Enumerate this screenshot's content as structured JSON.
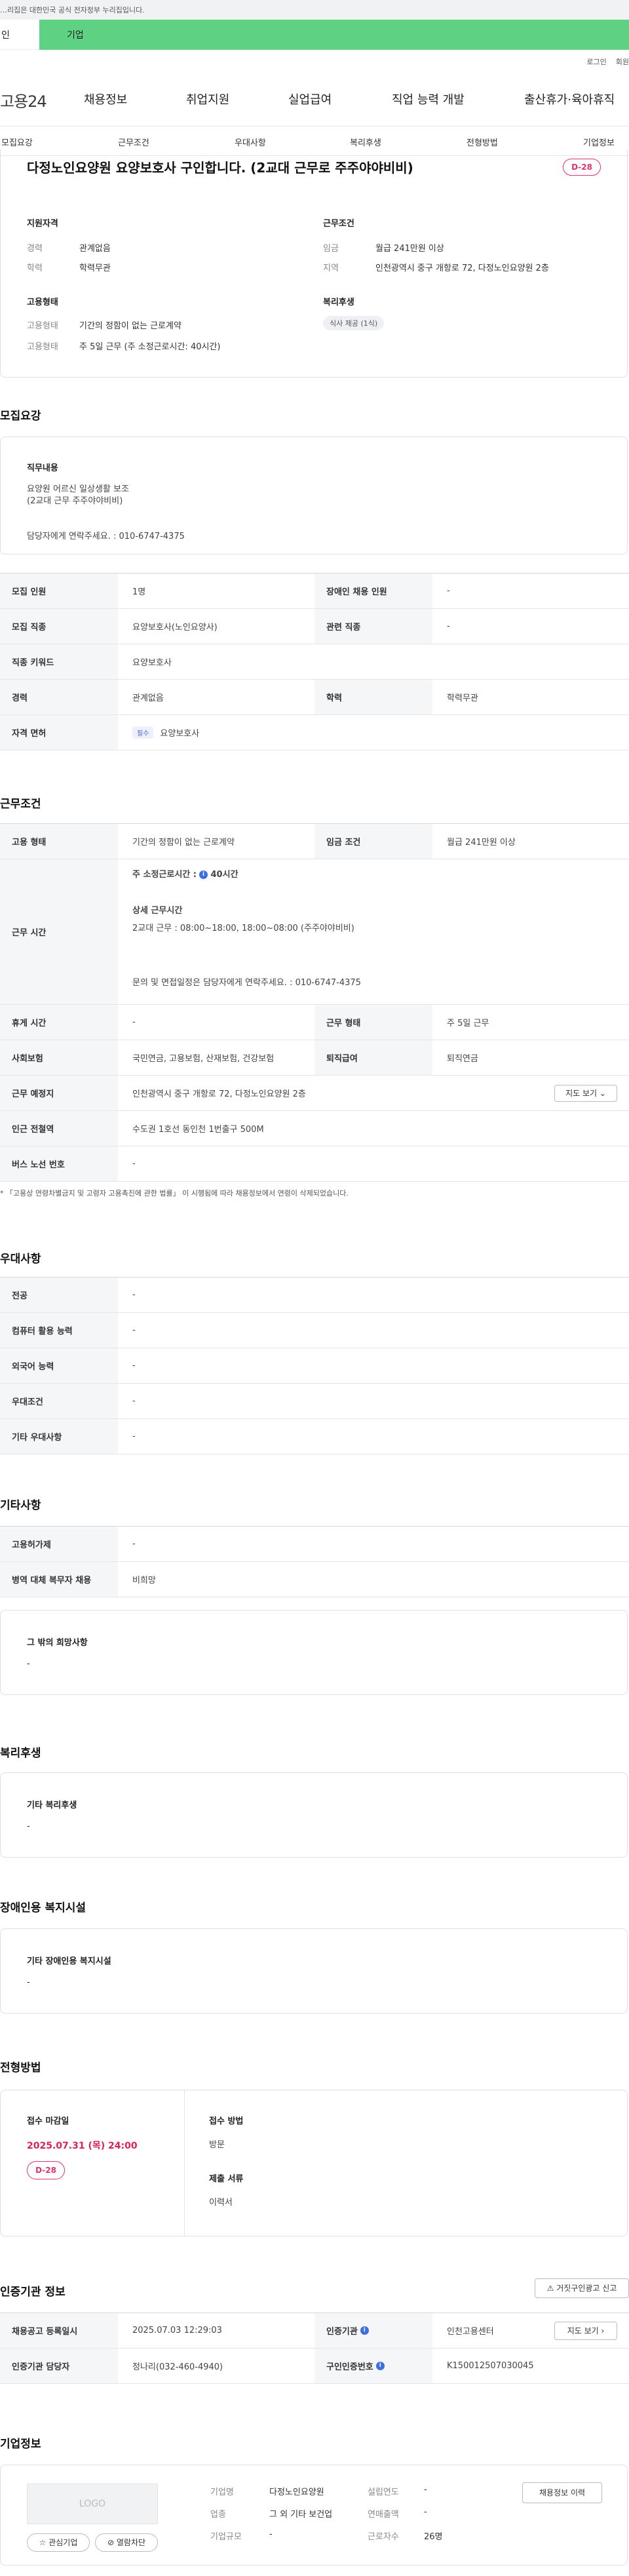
{
  "gov_banner": "…리집은 대한민국 공식 전자정부 누리집입니다.",
  "user_tabs": {
    "individual": "인",
    "business": "기업"
  },
  "util": {
    "login": "로그인",
    "signup": "회원"
  },
  "logo": "고용24",
  "gnb": [
    "채용정보",
    "취업지원",
    "실업급여",
    "직업 능력 개발",
    "출산휴가·육아휴직"
  ],
  "subnav": [
    "모집요강",
    "근무조건",
    "우대사항",
    "복리후생",
    "전형방법",
    "기업정보"
  ],
  "summary": {
    "title": "다정노인요양원 요양보호사 구인합니다. (2교대 근무로 주주야야비비)",
    "dday": "D-28",
    "qual_h": "지원자격",
    "career_k": "경력",
    "career_v": "관계없음",
    "edu_k": "학력",
    "edu_v": "학력무관",
    "emp_h": "고용형태",
    "emp_k1": "고용형태",
    "emp_v1": "기간의 정함이 없는 근로계약",
    "emp_k2": "고용형태",
    "emp_v2": "주 5일 근무 (주 소정근로시간: 40시간)",
    "cond_h": "근무조건",
    "wage_k": "임금",
    "wage_v": "월급 241만원 이상",
    "region_k": "지역",
    "region_v": "인천광역시 중구 개항로 72, 다정노인요양원 2층",
    "welfare_h": "복리후생",
    "welfare_chip": "식사 제공 (1식)"
  },
  "recruit": {
    "title": "모집요강",
    "job_h": "직무내용",
    "job_l1": "요양원 어르신 일상생활 보조",
    "job_l2": "(2교대 근무 주주야야비비)",
    "job_l3": "담당자에게 연락주세요. : 010-6747-4375",
    "rows": [
      [
        "모집 인원",
        "1명",
        "장애인 채용 인원",
        "-"
      ],
      [
        "모집 직종",
        "요양보호사(노인요양사)",
        "관련 직종",
        "-"
      ],
      [
        "직종 키워드",
        "요양보호사"
      ],
      [
        "경력",
        "관계없음",
        "학력",
        "학력무관"
      ]
    ],
    "license_k": "자격 면허",
    "license_tag": "필수",
    "license_v": "요양보호사"
  },
  "work": {
    "title": "근무조건",
    "emp_k": "고용 형태",
    "emp_v": "기간의 정함이 없는 근로계약",
    "wage_k": "임금 조건",
    "wage_v": "월급 241만원 이상",
    "time_k": "근무 시간",
    "time_l1": "주 소정근로시간 :",
    "time_hours": "40시간",
    "time_l2": "상세 근무시간",
    "time_l3": "2교대 근무 : 08:00~18:00, 18:00~08:00  (주주야야비비)",
    "time_l4": "문의 및 면접일정은 담당자에게 연락주세요. : 010-6747-4375",
    "rest_k": "휴게 시간",
    "rest_v": "-",
    "form_k": "근무 형태",
    "form_v": "주 5일 근무",
    "ins_k": "사회보험",
    "ins_v": "국민연금, 고용보험, 산재보험, 건강보험",
    "ret_k": "퇴직급여",
    "ret_v": "퇴직연금",
    "place_k": "근무 예정지",
    "place_v": "인천광역시 중구 개항로 72, 다정노인요양원 2층",
    "map_btn": "지도 보기",
    "sub_k": "인근 전철역",
    "sub_v": "수도권 1호선 동인천 1번출구 500M",
    "bus_k": "버스 노선 번호",
    "bus_v": "-",
    "note": "* 「고용상 연령차별금지 및 고령자 고용촉진에 관한 법률」 이 시행됨에 따라 채용정보에서 연령이 삭제되었습니다."
  },
  "pref": {
    "title": "우대사항",
    "rows": [
      [
        "전공",
        "-"
      ],
      [
        "컴퓨터 활용 능력",
        "-"
      ],
      [
        "외국어 능력",
        "-"
      ],
      [
        "우대조건",
        "-"
      ],
      [
        "기타 우대사항",
        "-"
      ]
    ]
  },
  "etc": {
    "title": "기타사항",
    "rows": [
      [
        "고용허가제",
        "-"
      ],
      [
        "병역 대체 복무자 채용",
        "비희망"
      ]
    ],
    "box_h": "그 밖의 희망사항",
    "box_v": "-"
  },
  "welfare": {
    "title": "복리후생",
    "box_h": "기타 복리후생",
    "box_v": "-"
  },
  "disabled": {
    "title": "장애인용 복지시설",
    "box_h": "기타 장애인용 복지시설",
    "box_v": "-"
  },
  "screen": {
    "title": "전형방법",
    "deadline_h": "접수 마감일",
    "deadline_v": "2025.07.31 (목) 24:00",
    "dday": "D-28",
    "method_h": "접수 방법",
    "method_v": "방문",
    "docs_h": "제출 서류",
    "docs_v": "이력서"
  },
  "agency": {
    "title": "인증기관 정보",
    "report_btn": "거짓구인광고 신고",
    "reg_k": "채용공고 등록일시",
    "reg_v": "2025.07.03 12:29:03",
    "org_k": "인증기관",
    "org_v": "인천고용센터",
    "map_btn": "지도 보기",
    "staff_k": "인증기관 담당자",
    "staff_v": "정나리(032-460-4940)",
    "cert_k": "구인인증번호",
    "cert_v": "K150012507030045"
  },
  "company": {
    "title": "기업정보",
    "logo": "LOGO",
    "fav_btn": "관심기업",
    "block_btn": "열람차단",
    "name_k": "기업명",
    "name_v": "다정노인요양원",
    "ind_k": "업종",
    "ind_v": "그 외 기타 보건업",
    "scale_k": "기업규모",
    "scale_v": "-",
    "year_k": "설립연도",
    "year_v": "-",
    "sales_k": "연매출액",
    "sales_v": "-",
    "emp_k": "근로자수",
    "emp_v": "26명",
    "history_btn": "채용정보 이력"
  }
}
